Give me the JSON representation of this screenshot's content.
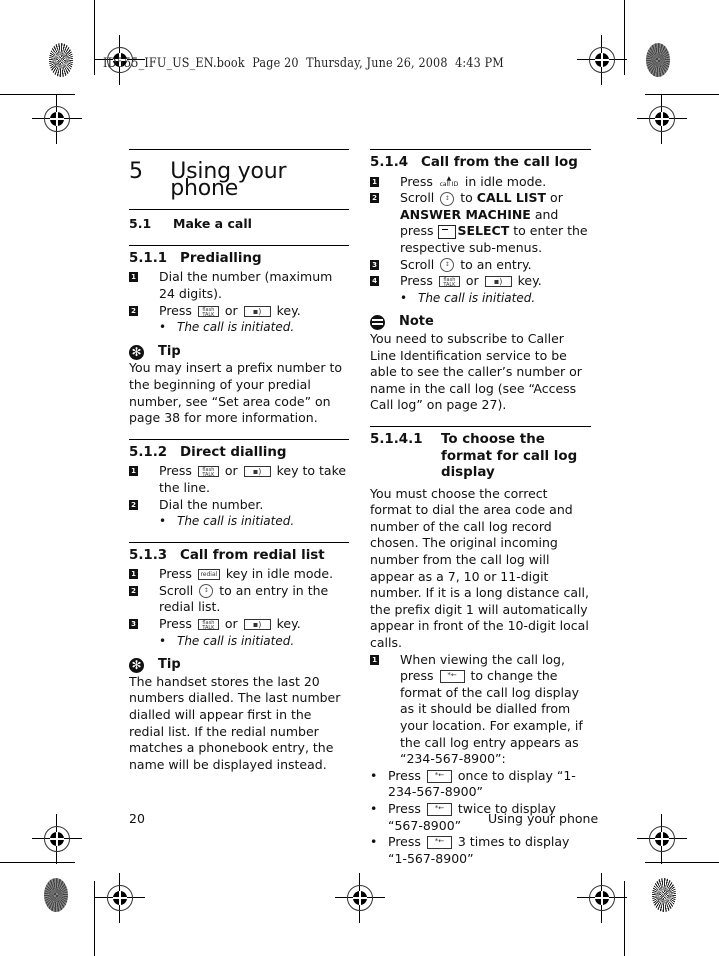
{
  "print_header": {
    "stamp": "ID555_IFU_US_EN.book  Page 20  Thursday, June 26, 2008  4:43 PM"
  },
  "chapter": {
    "number": "5",
    "title": "Using your phone"
  },
  "section_5_1": {
    "number": "5.1",
    "title": "Make a call"
  },
  "section_5_1_1": {
    "number": "5.1.1",
    "title": "Predialling",
    "steps": [
      {
        "n": "1",
        "text": "Dial the number (maximum 24 digits)."
      },
      {
        "n": "2",
        "pre": "Press",
        "mid": "or",
        "post": "key."
      }
    ],
    "result": "The call is initiated.",
    "tip_label": "Tip",
    "tip_text": "You may insert a prefix number to the beginning of your predial number, see “Set area code” on page 38 for more information."
  },
  "section_5_1_2": {
    "number": "5.1.2",
    "title": "Direct dialling",
    "steps": [
      {
        "n": "1",
        "pre": "Press",
        "mid": "or",
        "post": "key to take the line."
      },
      {
        "n": "2",
        "text": "Dial the number."
      }
    ],
    "result": "The call is initiated."
  },
  "section_5_1_3": {
    "number": "5.1.3",
    "title": "Call from redial list",
    "steps": [
      {
        "n": "1",
        "pre": "Press",
        "post": "key in idle mode."
      },
      {
        "n": "2",
        "pre": "Scroll",
        "post": "to an entry in the redial list."
      },
      {
        "n": "3",
        "pre": "Press",
        "mid": "or",
        "post": "key."
      }
    ],
    "result": "The call is initiated.",
    "tip_label": "Tip",
    "tip_text": "The handset stores the last 20 numbers dialled. The last number dialled will appear first in the redial list. If the redial number matches a phonebook entry, the name will be displayed instead."
  },
  "section_5_1_4": {
    "number": "5.1.4",
    "title": "Call from the call log",
    "steps": [
      {
        "n": "1",
        "pre": "Press",
        "post": "in idle mode."
      },
      {
        "n": "2",
        "pre": "Scroll",
        "mid1": "to",
        "bold1": "CALL LIST",
        "mid2": "or",
        "bold2": "ANSWER MACHINE",
        "mid3": "and press",
        "bold3": "SELECT",
        "post": "to enter the respective sub-menus."
      },
      {
        "n": "3",
        "pre": "Scroll",
        "post": "to an entry."
      },
      {
        "n": "4",
        "pre": "Press",
        "mid": "or",
        "post": "key."
      }
    ],
    "result": "The call is initiated.",
    "note_label": "Note",
    "note_text": "You need to subscribe to Caller Line Identification service to be able to see the caller’s number or name in the call log (see “Access Call log” on page 27)."
  },
  "section_5_1_4_1": {
    "number": "5.1.4.1",
    "title": "To choose the format for call log display",
    "intro": "You must choose the correct format to dial the area code and number of the call log record chosen. The original incoming number from the call log will appear as a 7, 10 or 11-digit number. If it is a long distance call, the prefix digit 1 will automatically appear in front of the 10-digit local calls.",
    "step1": {
      "n": "1",
      "pre": "When viewing the call log, press",
      "post": "to change the format of the call log display as it should be dialled from your location. For example, if the call log entry appears as “234-567-8900”:"
    },
    "bullets": [
      {
        "pre": "Press",
        "post": "once to display “1-234-567-8900”"
      },
      {
        "pre": "Press",
        "post": "twice to display “567-8900”"
      },
      {
        "pre": "Press",
        "post": "3 times to display “1-567-8900”"
      }
    ]
  },
  "keys": {
    "talk_top": "flash",
    "talk_bottom": "TALK",
    "speaker": "▪)",
    "redial": "redial",
    "scroll": "↕",
    "callid_arrow": "▲",
    "callid": "call ID",
    "format_top": "*←",
    "format_bottom": "format",
    "bullet": "•"
  },
  "footer": {
    "page_number": "20",
    "section_title": "Using your phone"
  }
}
